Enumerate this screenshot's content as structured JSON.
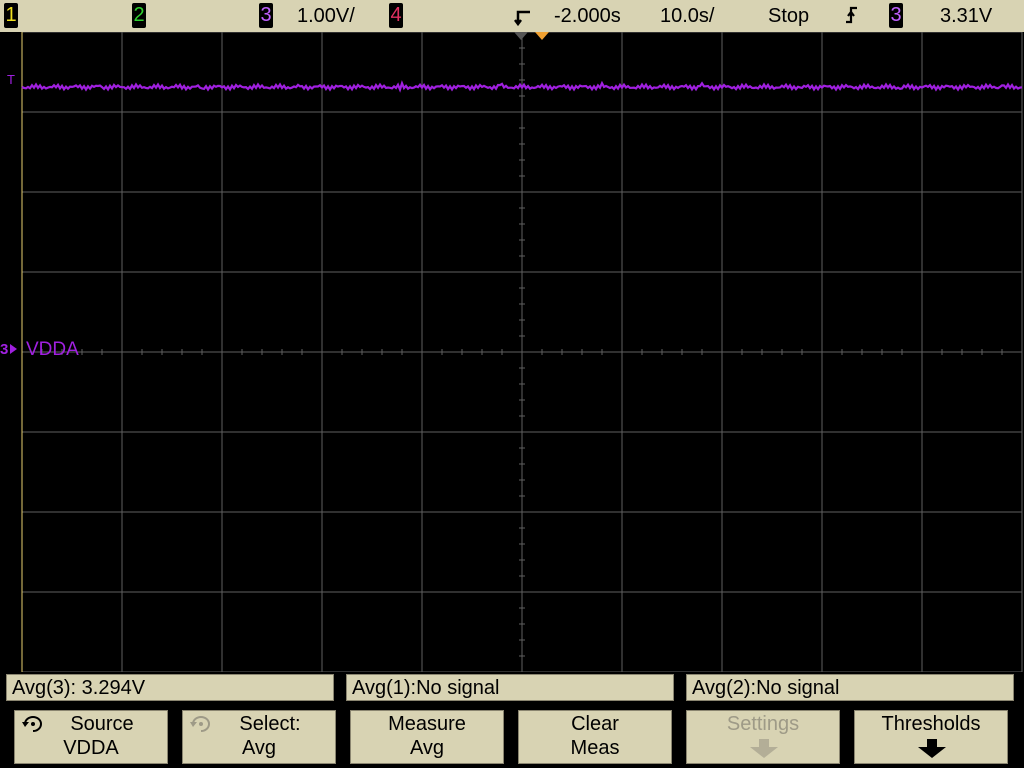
{
  "status": {
    "ch1": "1",
    "ch2": "2",
    "ch3": "3",
    "ch3_scale": "1.00V/",
    "ch4": "4",
    "delay": "-2.000s",
    "timebase": "10.0s/",
    "run_state": "Stop",
    "trigger_source": "3",
    "trigger_level": "3.31V"
  },
  "screen": {
    "trigger_marker": "T",
    "ch3_ground_marker": "3",
    "ch3_label": "VDDA"
  },
  "colors": {
    "ch1": "#f0e020",
    "ch2": "#30d030",
    "ch3": "#a020e0",
    "ch4": "#e03060",
    "grid": "#606060",
    "bar": "#d8d3b3",
    "marker": "#f0a030"
  },
  "measurements": [
    {
      "label": "Avg(3): 3.294V"
    },
    {
      "label": "Avg(1):No signal"
    },
    {
      "label": "Avg(2):No signal"
    }
  ],
  "softkeys": [
    {
      "line1": "Source",
      "line2": "VDDA",
      "icon": "rotate-knob-icon"
    },
    {
      "line1": "Select:",
      "line2": "Avg",
      "icon": "rotate-knob-icon"
    },
    {
      "line1": "Measure",
      "line2": "Avg"
    },
    {
      "line1": "Clear",
      "line2": "Meas"
    },
    {
      "line1": "Settings",
      "line2": "",
      "icon": "down-arrow-icon"
    },
    {
      "line1": "Thresholds",
      "line2": "",
      "icon": "down-arrow-icon"
    }
  ]
}
